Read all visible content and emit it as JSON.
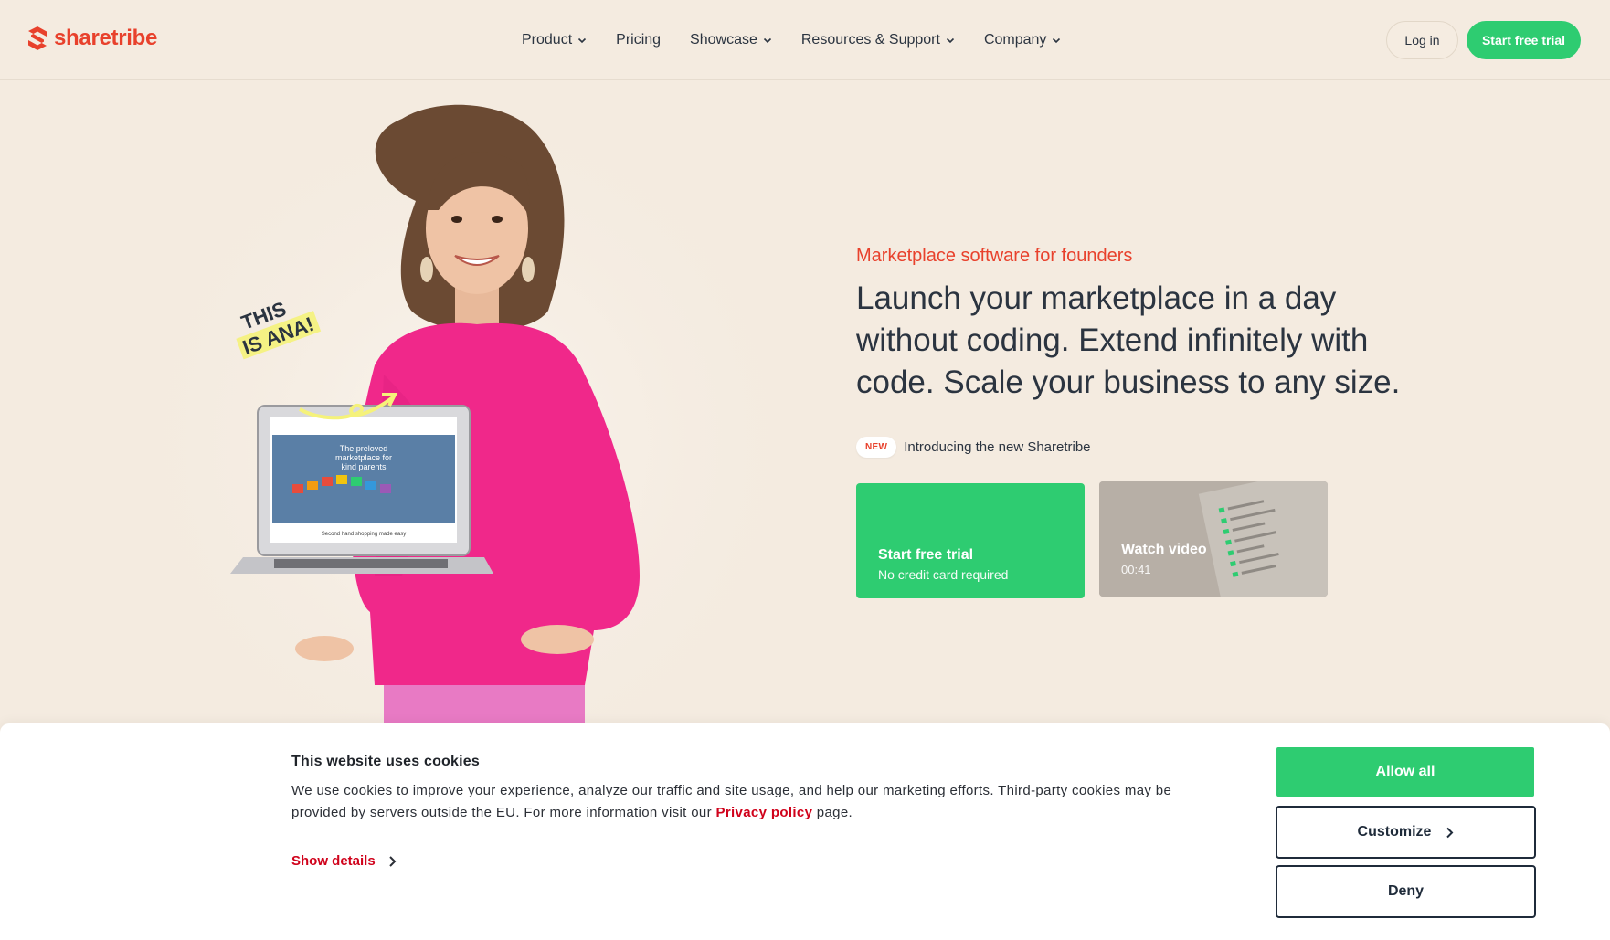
{
  "brand": {
    "name": "sharetribe",
    "color": "#e8412c"
  },
  "nav": {
    "items": [
      {
        "label": "Product",
        "dropdown": true
      },
      {
        "label": "Pricing",
        "dropdown": false
      },
      {
        "label": "Showcase",
        "dropdown": true
      },
      {
        "label": "Resources & Support",
        "dropdown": true
      },
      {
        "label": "Company",
        "dropdown": true
      }
    ],
    "login_label": "Log in",
    "trial_label": "Start free trial"
  },
  "hero": {
    "eyebrow": "Marketplace software for founders",
    "headline": "Launch your marketplace in a day without coding. Extend infinitely with code. Scale your business to any size.",
    "announcement": {
      "badge": "NEW",
      "text": "Introducing the new Sharetribe"
    },
    "cta": {
      "title": "Start free trial",
      "subtitle": "No credit card required"
    },
    "video": {
      "title": "Watch video",
      "duration": "00:41"
    },
    "photo_sticker": {
      "line1": "THIS",
      "line2": "IS ANA!"
    },
    "laptop_screen": {
      "heading_line1": "The preloved",
      "heading_line2": "marketplace for",
      "heading_line3": "kind parents",
      "footer": "Second hand shopping made easy"
    }
  },
  "cookie": {
    "title": "This website uses cookies",
    "text_before": "We use cookies to improve your experience, analyze our traffic and site usage, and help our marketing efforts. Third-party cookies may be provided by servers outside the EU. For more information visit our ",
    "link": "Privacy policy",
    "text_after": " page.",
    "show_details": "Show details",
    "allow_all": "Allow all",
    "customize": "Customize",
    "deny": "Deny"
  },
  "colors": {
    "accent_green": "#2ecc71",
    "accent_red": "#e8412c",
    "background": "#f4ebe0",
    "sweater_pink": "#f0288a"
  }
}
